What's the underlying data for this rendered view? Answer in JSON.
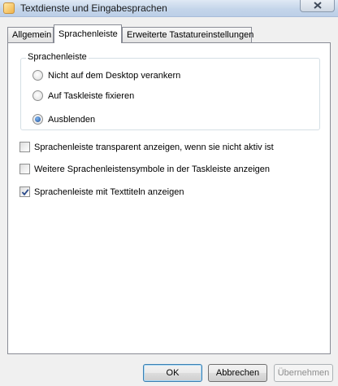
{
  "window": {
    "title": "Textdienste und Eingabesprachen",
    "icon": "keyboard-settings-icon"
  },
  "tabs": [
    {
      "label": "Allgemein",
      "active": false
    },
    {
      "label": "Sprachenleiste",
      "active": true
    },
    {
      "label": "Erweiterte Tastatureinstellungen",
      "active": false
    }
  ],
  "language_bar": {
    "group_title": "Sprachenleiste",
    "radios": [
      {
        "label": "Nicht auf dem Desktop verankern",
        "checked": false
      },
      {
        "label": "Auf Taskleiste fixieren",
        "checked": false
      },
      {
        "label": "Ausblenden",
        "checked": true
      }
    ],
    "checkboxes": [
      {
        "label": "Sprachenleiste transparent anzeigen, wenn sie nicht aktiv ist",
        "checked": false
      },
      {
        "label": "Weitere Sprachenleistensymbole in der Taskleiste anzeigen",
        "checked": false
      },
      {
        "label": "Sprachenleiste mit Texttiteln anzeigen",
        "checked": true
      }
    ]
  },
  "buttons": {
    "ok": "OK",
    "cancel": "Abbrechen",
    "apply": "Übernehmen"
  }
}
